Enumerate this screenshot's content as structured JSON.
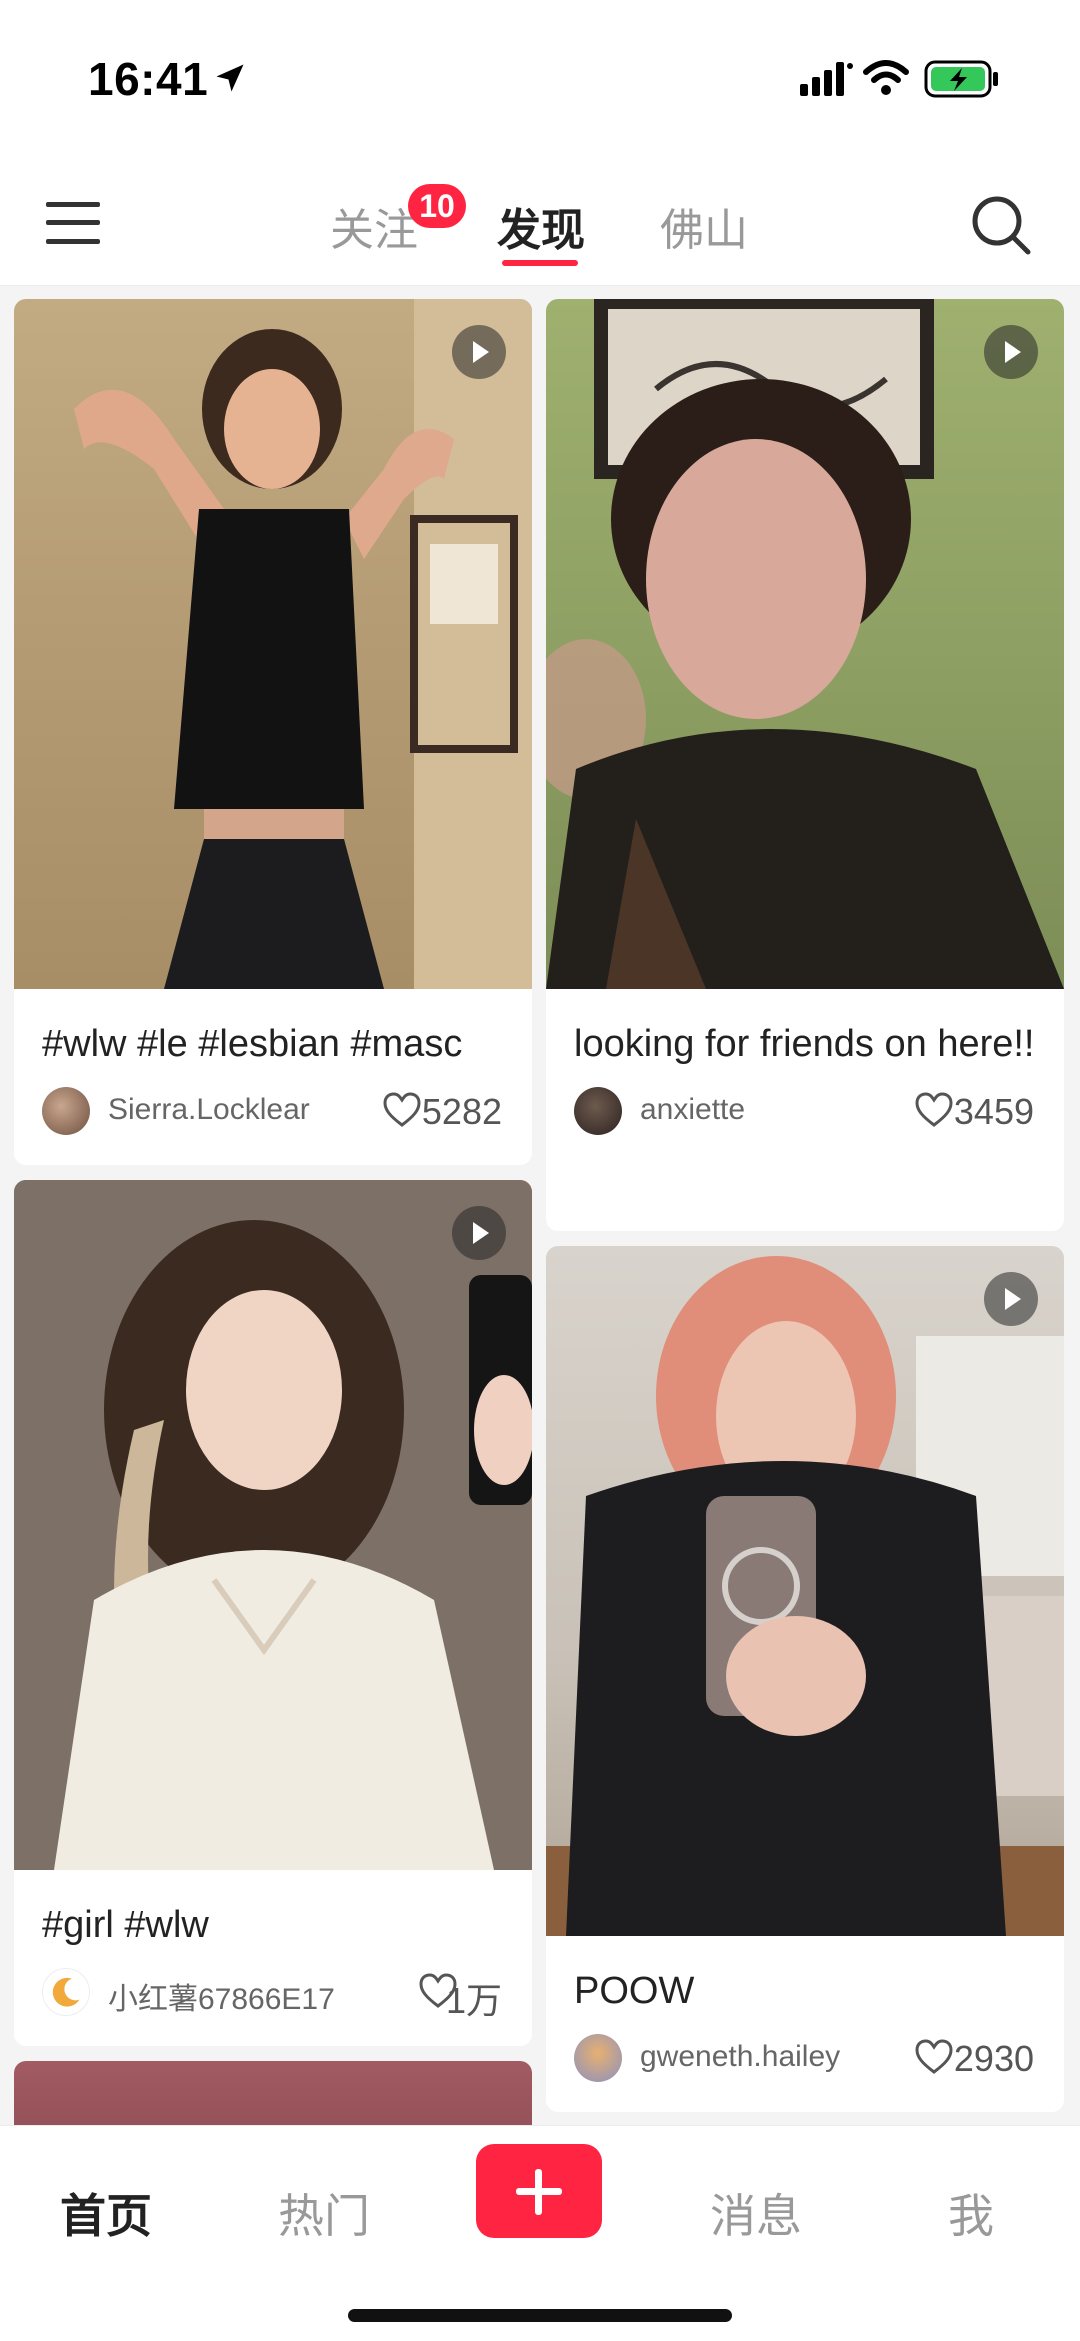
{
  "status_bar": {
    "time": "16:41",
    "icons": [
      "location-arrow-icon",
      "cellular-signal-icon",
      "wifi-icon",
      "battery-charging-icon"
    ]
  },
  "top_nav": {
    "tabs": [
      {
        "label": "关注",
        "badge": "10",
        "active": false
      },
      {
        "label": "发现",
        "active": true
      },
      {
        "label": "佛山",
        "active": false
      }
    ],
    "accent_color": "#ff2442"
  },
  "feed": {
    "cards": [
      {
        "title": "#wlw #le #lesbian #masc",
        "author": "Sierra.Locklear",
        "likes": "5282",
        "is_video": true
      },
      {
        "title": "looking for friends on here!!",
        "author": "anxiette",
        "likes": "3459",
        "is_video": true
      },
      {
        "title": "#girl #wlw",
        "author": "小红薯67866E17",
        "likes": "1万",
        "is_video": true
      },
      {
        "title": "POOW",
        "author": "gweneth.hailey",
        "likes": "2930",
        "is_video": true
      }
    ]
  },
  "bottom_nav": {
    "items": [
      {
        "label": "首页",
        "active": true
      },
      {
        "label": "热门",
        "active": false
      },
      {
        "label": "消息",
        "active": false
      },
      {
        "label": "我",
        "active": false
      }
    ]
  }
}
